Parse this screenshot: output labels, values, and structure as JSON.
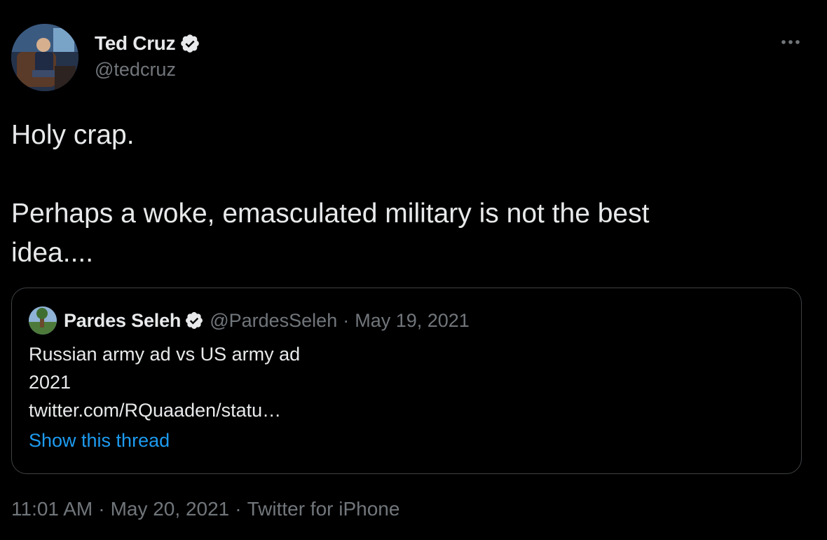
{
  "tweet": {
    "author": {
      "name": "Ted Cruz",
      "handle": "@tedcruz",
      "verified": true
    },
    "text_line1": "Holy crap.",
    "text_line2": "Perhaps a woke, emasculated military is not the best",
    "text_line3": "idea....",
    "quoted": {
      "name": "Pardes Seleh",
      "handle": "@PardesSeleh",
      "separator": "·",
      "date": "May 19, 2021",
      "verified": true,
      "line1": "Russian army ad vs US army ad",
      "line2": "2021",
      "line3": "twitter.com/RQuaaden/statu…",
      "thread_link": "Show this thread"
    },
    "footer": {
      "time": "11:01 AM",
      "date": "May 20, 2021",
      "source": "Twitter for iPhone",
      "separator": "·"
    }
  },
  "colors": {
    "background": "#000000",
    "primary_text": "#e7e9ea",
    "secondary_text": "#71767b",
    "link": "#1d9bf0",
    "border": "#3e4144"
  },
  "icons": {
    "verified": "verified-badge-icon",
    "more": "more-horizontal-icon"
  }
}
